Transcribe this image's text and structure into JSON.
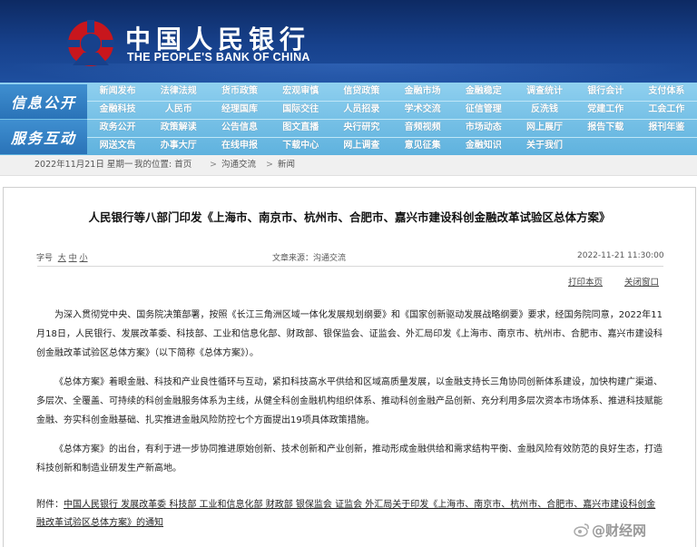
{
  "header": {
    "cn_name": "中国人民银行",
    "en_name": "THE PEOPLE'S BANK OF CHINA"
  },
  "nav": {
    "label1": "信息公开",
    "label2": "服务互动",
    "rows": [
      [
        "新闻发布",
        "法律法规",
        "货币政策",
        "宏观审慎",
        "信贷政策",
        "金融市场",
        "金融稳定",
        "调查统计",
        "银行会计",
        "支付体系"
      ],
      [
        "金融科技",
        "人民币",
        "经理国库",
        "国际交往",
        "人员招录",
        "学术交流",
        "征信管理",
        "反洗钱",
        "党建工作",
        "工会工作"
      ],
      [
        "政务公开",
        "政策解读",
        "公告信息",
        "图文直播",
        "央行研究",
        "音频视频",
        "市场动态",
        "网上展厅",
        "报告下载",
        "报刊年鉴"
      ],
      [
        "网送文告",
        "办事大厅",
        "在线申报",
        "下载中心",
        "网上调查",
        "意见征集",
        "金融知识",
        "关于我们",
        "",
        ""
      ]
    ]
  },
  "breadcrumb": {
    "date": "2022年11月21日 星期一",
    "position": "我的位置: 首页",
    "sep1": ">",
    "level1": "沟通交流",
    "sep2": ">",
    "level2": "新闻"
  },
  "article": {
    "title": "人民银行等八部门印发《上海市、南京市、杭州市、合肥市、嘉兴市建设科创金融改革试验区总体方案》",
    "font_label": "字号",
    "font_sizes": [
      "大",
      "中",
      "小"
    ],
    "source": "文章来源：沟通交流",
    "datetime": "2022-11-21  11:30:00",
    "print_label": "打印本页",
    "close_label": "关闭窗口",
    "paragraphs": [
      "为深入贯彻党中央、国务院决策部署，按照《长江三角洲区域一体化发展规划纲要》和《国家创新驱动发展战略纲要》要求，经国务院同意，2022年11月18日，人民银行、发展改革委、科技部、工业和信息化部、财政部、银保监会、证监会、外汇局印发《上海市、南京市、杭州市、合肥市、嘉兴市建设科创金融改革试验区总体方案》（以下简称《总体方案》）。",
      "《总体方案》着眼金融、科技和产业良性循环与互动，紧扣科技高水平供给和区域高质量发展，以金融支持长三角协同创新体系建设，加快构建广渠道、多层次、全覆盖、可持续的科创金融服务体系为主线，从健全科创金融机构组织体系、推动科创金融产品创新、充分利用多层次资本市场体系、推进科技赋能金融、夯实科创金融基础、扎实推进金融风险防控七个方面提出19项具体政策措施。",
      "《总体方案》的出台，有利于进一步协同推进原始创新、技术创新和产业创新，推动形成金融供给和需求结构平衡、金融风险有效防范的良好生态，打造科技创新和制造业研发生产新高地。"
    ],
    "attachment_label": "附件：",
    "attachment_text": "中国人民银行 发展改革委 科技部 工业和信息化部 财政部 银保监会 证监会 外汇局关于印发《上海市、南京市、杭州市、合肥市、嘉兴市建设科创金融改革试验区总体方案》的通知"
  },
  "watermark": "@财经网",
  "colors": {
    "header": "#17418c",
    "nav": "#6bbbe3",
    "brand_red": "#c8161d"
  }
}
